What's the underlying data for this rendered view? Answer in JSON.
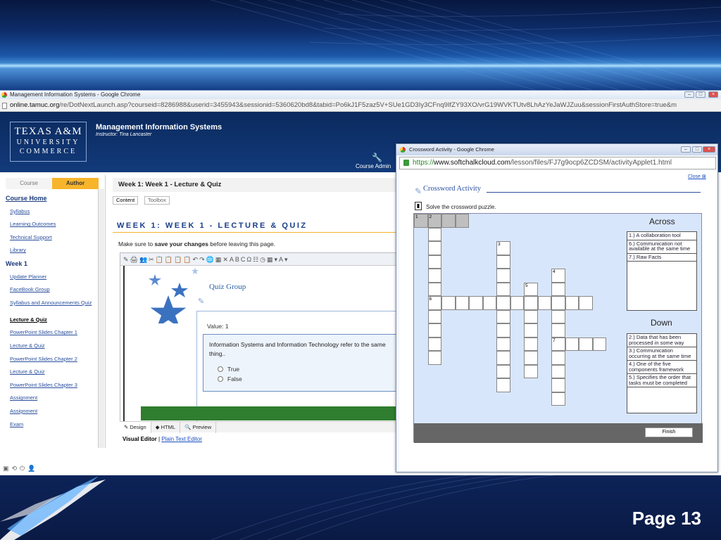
{
  "slide": {
    "page_label": "Page 13"
  },
  "main_window": {
    "title": "Management Information Systems - Google Chrome",
    "url_host": "online.tamuc.org",
    "url_path": "/re/DotNextLaunch.asp?courseid=8286988&userid=3455943&sessionid=5360620bd8&tabid=Po6kJ1F5zaz5V+SUe1GD3Iy3CFnq9IfZY93XO/vrG19WVKTUtv8LhAzYeJaWJZuu&sessionFirstAuthStore=true&m"
  },
  "header": {
    "logo": {
      "line1": "TEXAS A&M",
      "line2": "UNIVERSITY",
      "line3": "COMMERCE"
    },
    "app_title": "Management Information Systems",
    "instructor": "Instructor:  Tina Lancaster",
    "course_admin": "Course Admin"
  },
  "nav": {
    "tab_course": "Course",
    "tab_author": "Author",
    "items": [
      {
        "label": "Course Home",
        "style": "heading"
      },
      {
        "label": "Syllabus"
      },
      {
        "label": "Learning Outcomes"
      },
      {
        "label": "Technical Support"
      },
      {
        "label": "Library"
      },
      {
        "label": "Week 1",
        "style": "bold"
      },
      {
        "label": "Update Planner"
      },
      {
        "label": "FaceBook Group"
      },
      {
        "label": "Syllabus and Announcements Quiz",
        "style": "wrap"
      },
      {
        "label": "Lecture & Quiz",
        "style": "active"
      },
      {
        "label": "PowerPoint Slides Chapter 1"
      },
      {
        "label": "Lecture & Quiz"
      },
      {
        "label": "PowerPoint Slides Chapter 2"
      },
      {
        "label": "Lecture & Quiz"
      },
      {
        "label": "PowerPoint Slides Chapter 3"
      },
      {
        "label": "Assignment"
      },
      {
        "label": "Assignment"
      },
      {
        "label": "Exam"
      }
    ]
  },
  "content": {
    "breadcrumb": "Week 1: Week 1 - Lecture & Quiz",
    "btn_content": "Content",
    "btn_toolbox": "Toolbox",
    "section_title": "WEEK 1: WEEK 1 - LECTURE & QUIZ",
    "note_prefix": "Make sure to ",
    "note_bold": "save your changes",
    "note_suffix": " before leaving this page.",
    "quiz_group": "Quiz Group",
    "question_value": "Value: 1",
    "question_text": "Information Systems and Information Technology refer to the same thing..",
    "options": [
      "True",
      "False"
    ],
    "editor_tabs": [
      "Design",
      "HTML",
      "Preview"
    ],
    "visual_editor": "Visual Editor",
    "separator": " | ",
    "plain_text_editor": "Plain Text Editor"
  },
  "popup": {
    "title": "Crossword Activity - Google Chrome",
    "url_scheme": "https://",
    "url_host": "www.softchalkcloud.com",
    "url_path": "/lesson/files/FJ7g9ocp6ZCDSM/activityApplet1.html",
    "close_label": "Close",
    "activity_title": "Crossword Activity",
    "instruction": "Solve the crossword puzzle.",
    "across_heading": "Across",
    "down_heading": "Down",
    "across_clues": [
      "1.) A collaboration tool",
      "6.) Communication not available at the same time",
      "7.) Raw Facts"
    ],
    "down_clues": [
      "2.) Data that has been processed in some way",
      "3.) Communication occurring at the same time",
      "4.) One of the five components framework",
      "5.) Specifies the order that tasks must be completed"
    ],
    "finish_label": "Finish"
  },
  "colors": {
    "accent_gold": "#f7b52b",
    "tamuc_blue": "#0b2a5e",
    "quiz_green": "#2f7d2f"
  }
}
